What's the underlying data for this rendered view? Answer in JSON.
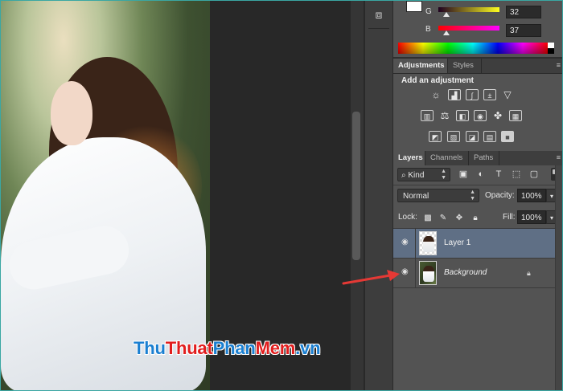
{
  "color_panel": {
    "channels": [
      {
        "label": "G",
        "value": "32"
      },
      {
        "label": "B",
        "value": "37"
      }
    ]
  },
  "adjustments_panel": {
    "tabs": [
      "Adjustments",
      "Styles"
    ],
    "title": "Add an adjustment",
    "icons": [
      "brightness-contrast-icon",
      "levels-icon",
      "curves-icon",
      "exposure-icon",
      "gradient-triangle-icon",
      "vibrance-icon",
      "balance-icon",
      "photo-filter-icon",
      "channel-mixer-icon",
      "color-lookup-icon",
      "grid-icon",
      "invert-icon",
      "posterize-icon",
      "threshold-icon",
      "gradient-map-icon",
      "selective-color-icon"
    ]
  },
  "layers_panel": {
    "tabs": [
      "Layers",
      "Channels",
      "Paths"
    ],
    "kind_filter": "Kind",
    "blend_mode": "Normal",
    "opacity_label": "Opacity:",
    "opacity_value": "100%",
    "lock_label": "Lock:",
    "fill_label": "Fill:",
    "fill_value": "100%",
    "layers": [
      {
        "name": "Layer 1",
        "selected": true
      },
      {
        "name": "Background",
        "selected": false,
        "locked": true
      }
    ]
  },
  "watermark": {
    "part1": "Thu",
    "part2": "Thuat",
    "part3": "Phan",
    "part4": "Mem",
    "part5": ".vn"
  },
  "colors": {
    "selected_layer": "#5f6f85",
    "panel_bg": "#535353",
    "arrow": "#e53935"
  }
}
